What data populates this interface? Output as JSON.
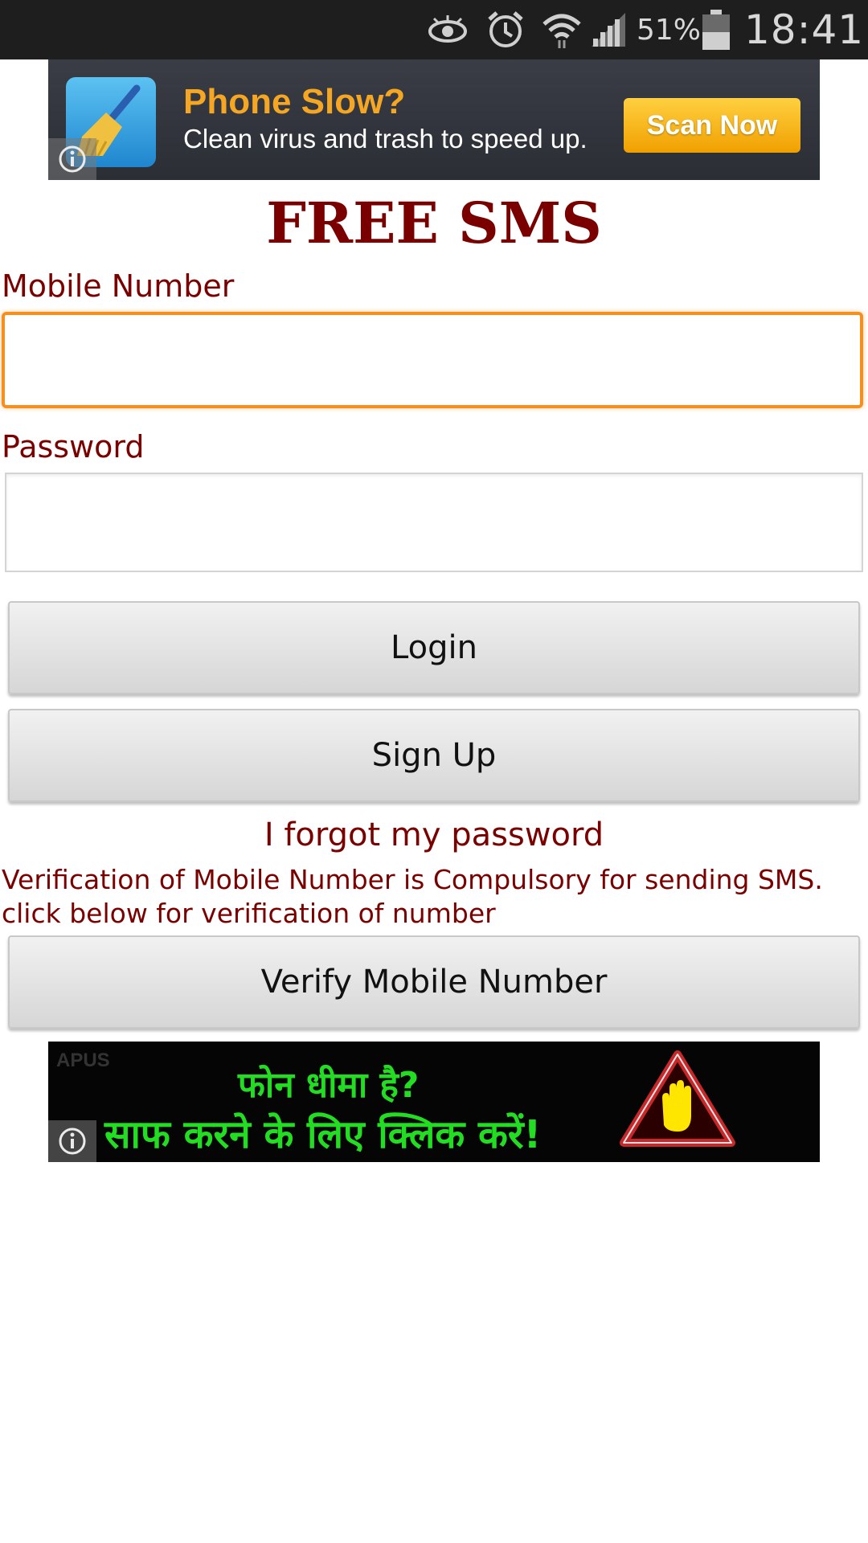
{
  "status_bar": {
    "battery_percent": "51%",
    "time": "18:41",
    "icons": [
      "eye-icon",
      "alarm-icon",
      "wifi-icon",
      "signal-icon",
      "battery-icon"
    ]
  },
  "ad_top": {
    "headline": "Phone Slow?",
    "subline": "Clean virus and trash to speed up.",
    "cta": "Scan Now"
  },
  "form": {
    "title": "FREE SMS",
    "mobile_label": "Mobile Number",
    "mobile_value": "",
    "password_label": "Password",
    "password_value": "",
    "login_label": "Login",
    "signup_label": "Sign Up",
    "forgot_label": "I forgot my password",
    "verify_note_line1": "Verification of Mobile Number is Compulsory for sending SMS.",
    "verify_note_line2": "click below for verification of number",
    "verify_label": "Verify Mobile Number"
  },
  "ad_bottom": {
    "brand": "APUS",
    "line1": "फोन धीमा है?",
    "line2": "साफ करने के लिए क्लिक करें!"
  },
  "colors": {
    "accent": "#7a0000",
    "focus_border": "#f5901e",
    "status_bar": "#1e1e1e"
  }
}
